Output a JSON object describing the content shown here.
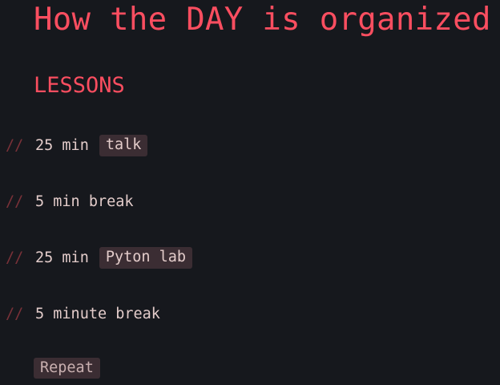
{
  "title": "How the DAY is organized",
  "section_heading": "LESSONS",
  "comment_marker": "//",
  "items": [
    {
      "text": "25 min",
      "tag": "talk"
    },
    {
      "text": "5 min break"
    },
    {
      "text": "25 min",
      "tag": "Pyton lab"
    },
    {
      "text": "5 minute break"
    }
  ],
  "repeat_label": "Repeat",
  "colors": {
    "background": "#16181d",
    "accent": "#fb4e60",
    "text": "#e3ccca",
    "chip_bg": "#3b2d33",
    "marker": "#7a3138"
  }
}
